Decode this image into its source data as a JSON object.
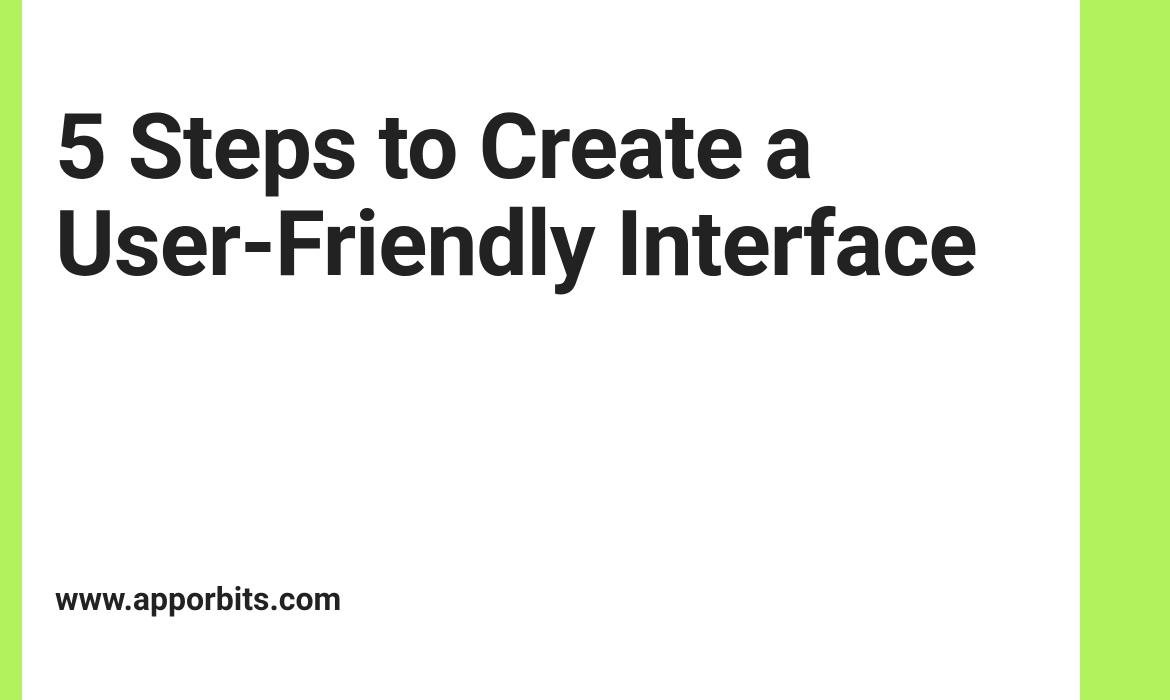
{
  "title": "5 Steps to Create a User-Friendly Interface",
  "url": "www.apporbits.com",
  "colors": {
    "accent": "#b1f25d",
    "text": "#222222",
    "background": "#ffffff"
  }
}
